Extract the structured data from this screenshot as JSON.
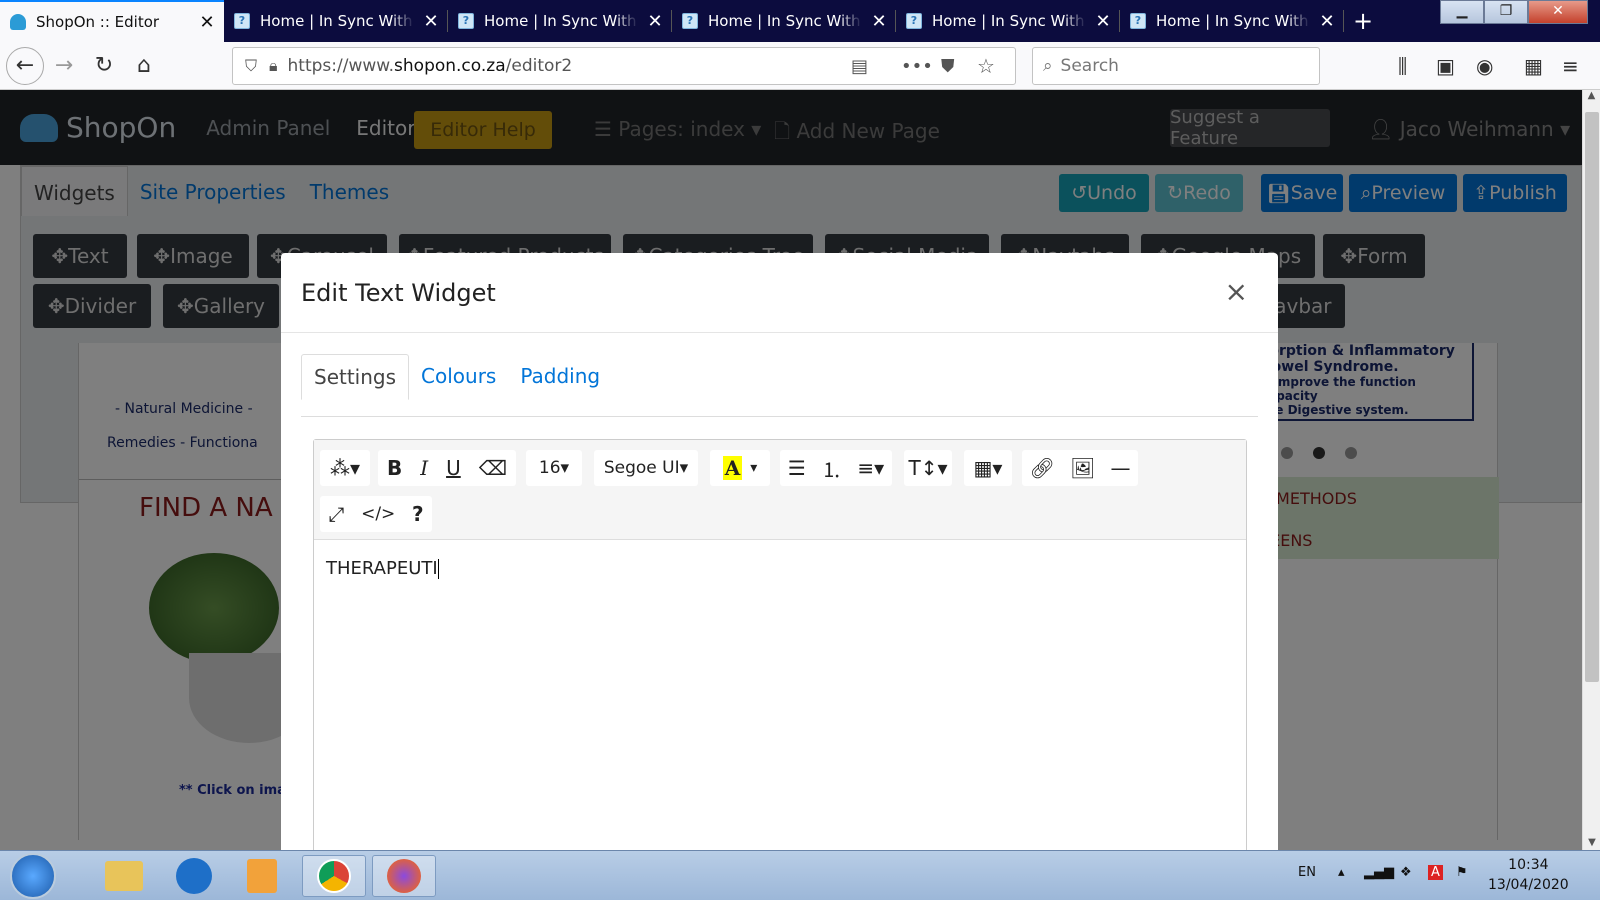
{
  "browser": {
    "tabs": [
      {
        "title": "ShopOn :: Editor",
        "active": true
      },
      {
        "title": "Home | In Sync With N",
        "active": false
      },
      {
        "title": "Home | In Sync With N",
        "active": false
      },
      {
        "title": "Home | In Sync With N",
        "active": false
      },
      {
        "title": "Home | In Sync With N",
        "active": false
      },
      {
        "title": "Home | In Sync With N",
        "active": false
      }
    ],
    "url_prefix": "https://www.",
    "url_domain": "shopon.co.za",
    "url_path": "/editor2",
    "search_placeholder": "Search"
  },
  "site_header": {
    "logo_text": "ShopOn",
    "admin_panel": "Admin Panel",
    "editor": "Editor",
    "editor_help": "Editor Help",
    "pages": "Pages: index",
    "add_new_page": "Add New Page",
    "suggest_feature": "Suggest a Feature",
    "user_name": "Jaco Weihmann"
  },
  "editor_bar": {
    "tabs": [
      "Widgets",
      "Site Properties",
      "Themes"
    ],
    "undo": "Undo",
    "redo": "Redo",
    "save": "Save",
    "preview": "Preview",
    "publish": "Publish",
    "widgets_row1": [
      "Text",
      "Image",
      "Carousel",
      "Featured Products",
      "Categories Tree",
      "Social Media",
      "Navtabs",
      "Google Maps",
      "Form"
    ],
    "widgets_row2": [
      "Divider",
      "Gallery",
      "Navbar"
    ]
  },
  "background_page": {
    "tagline_1": "- Natural Medicine -",
    "tagline_2": "Remedies - Functiona",
    "heading": "FIND A NA",
    "click_hint": "** Click on imag",
    "right_text_1": "sorption & Inflammatory",
    "right_text_2": "Bowel Syndrome.",
    "right_text_3": "o Improve the function capacity",
    "right_text_4": "the Digestive system.",
    "right_link_1": "N METHODS",
    "right_link_2": "REENS"
  },
  "modal": {
    "title": "Edit Text Widget",
    "tabs": [
      "Settings",
      "Colours",
      "Padding"
    ],
    "font_size": "16",
    "font_family": "Segoe UI",
    "content": "THERAPEUTI"
  },
  "taskbar": {
    "lang": "EN",
    "time": "10:34",
    "date": "13/04/2020"
  },
  "colors": {
    "primary": "#0275d8",
    "teal": "#17a2b8",
    "dark": "#343a40",
    "help": "#c79a12"
  }
}
